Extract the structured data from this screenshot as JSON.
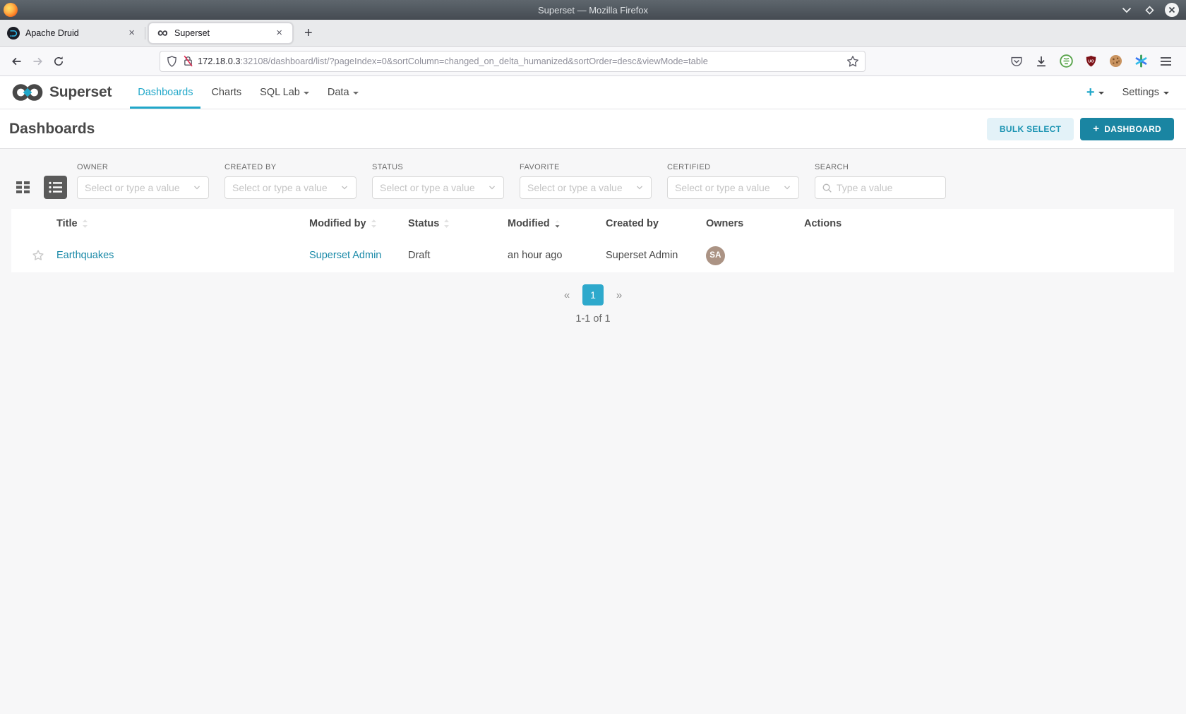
{
  "browser": {
    "window_title": "Superset — Mozilla Firefox",
    "tabs": [
      {
        "label": "Apache Druid",
        "close": "×"
      },
      {
        "label": "Superset",
        "close": "×"
      }
    ],
    "new_tab": "+",
    "url_host": "172.18.0.3",
    "url_rest": ":32108/dashboard/list/?pageIndex=0&sortColumn=changed_on_delta_humanized&sortOrder=desc&viewMode=table"
  },
  "navbar": {
    "brand": "Superset",
    "items": [
      {
        "label": "Dashboards",
        "active": true
      },
      {
        "label": "Charts",
        "active": false
      },
      {
        "label": "SQL Lab",
        "active": false,
        "has_dropdown": true
      },
      {
        "label": "Data",
        "active": false,
        "has_dropdown": true
      }
    ],
    "plus_button": "+",
    "settings": "Settings"
  },
  "header": {
    "title": "Dashboards",
    "bulk_select_label": "BULK SELECT",
    "add_button_plus": "+",
    "add_button_label": "DASHBOARD"
  },
  "filters": {
    "owner": {
      "label": "OWNER",
      "placeholder": "Select or type a value"
    },
    "created_by": {
      "label": "CREATED BY",
      "placeholder": "Select or type a value"
    },
    "status": {
      "label": "STATUS",
      "placeholder": "Select or type a value"
    },
    "favorite": {
      "label": "FAVORITE",
      "placeholder": "Select or type a value"
    },
    "certified": {
      "label": "CERTIFIED",
      "placeholder": "Select or type a value"
    },
    "search": {
      "label": "SEARCH",
      "placeholder": "Type a value",
      "value": ""
    }
  },
  "table": {
    "columns": [
      {
        "label": "Title",
        "sortable": true,
        "sorted": "none"
      },
      {
        "label": "Modified by",
        "sortable": true,
        "sorted": "none"
      },
      {
        "label": "Status",
        "sortable": true,
        "sorted": "none"
      },
      {
        "label": "Modified",
        "sortable": true,
        "sorted": "desc"
      },
      {
        "label": "Created by",
        "sortable": false
      },
      {
        "label": "Owners",
        "sortable": false
      },
      {
        "label": "Actions",
        "sortable": false
      }
    ],
    "rows": [
      {
        "title": "Earthquakes",
        "modified_by": "Superset Admin",
        "status": "Draft",
        "modified": "an hour ago",
        "created_by": "Superset Admin",
        "owner_initials": "SA"
      }
    ]
  },
  "pagination": {
    "prev": "«",
    "page": "1",
    "next": "»",
    "summary": "1-1 of 1"
  },
  "colors": {
    "accent": "#20A7C9",
    "primary_button": "#1A85A2",
    "secondary_button_bg": "#E3F2F8",
    "link": "#1B8AA8",
    "avatar_bg": "#AB9384",
    "page_bg": "#F7F7F8"
  }
}
